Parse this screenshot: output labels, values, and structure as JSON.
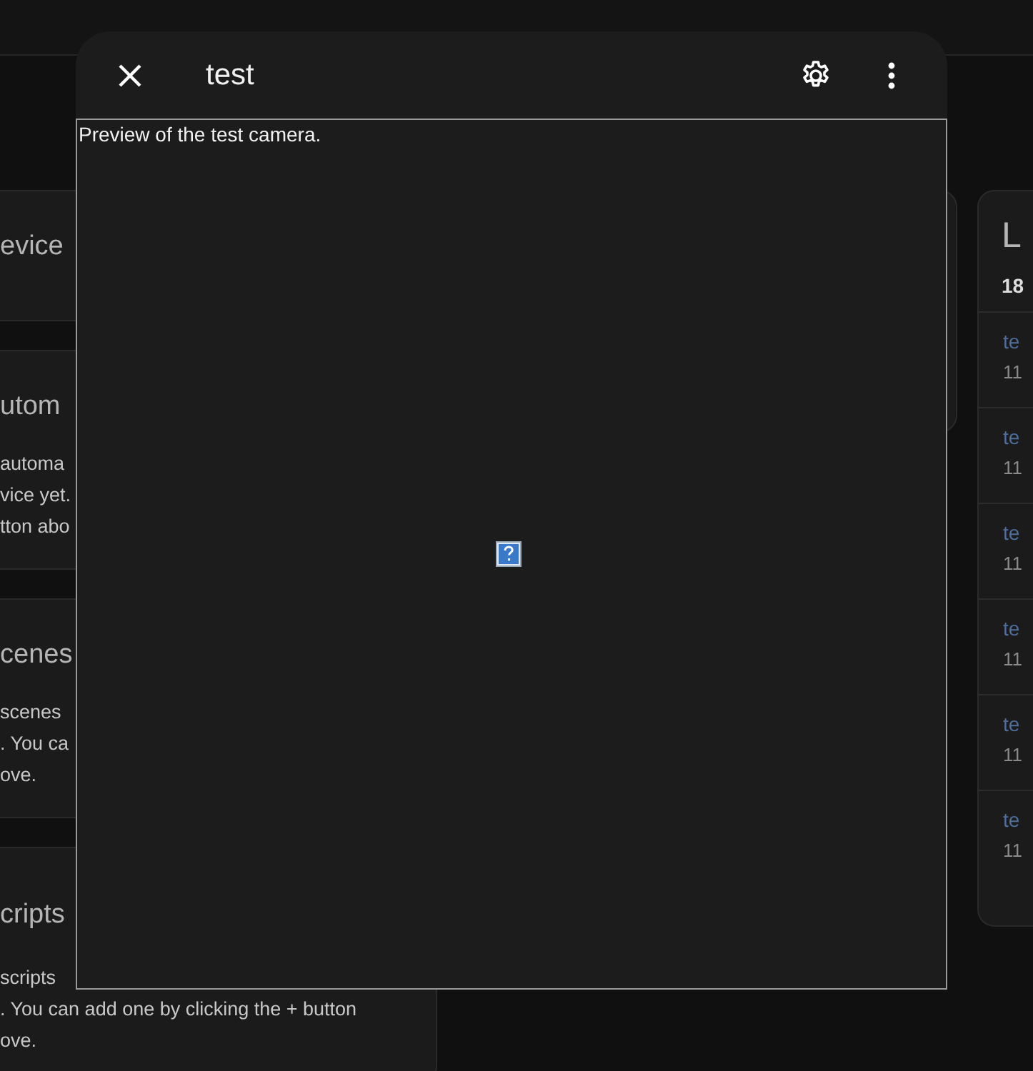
{
  "left_cards": [
    {
      "title": "evice"
    },
    {
      "title": "utom",
      "lines": [
        " automa",
        "vice yet.",
        "tton abo"
      ]
    },
    {
      "title": "cenes",
      "lines": [
        " scenes",
        ". You ca",
        "ove."
      ]
    },
    {
      "title": "cripts",
      "lines": [
        " scripts",
        ". You can add one by clicking the + button",
        "ove."
      ]
    }
  ],
  "logbook_card": {
    "title": "L",
    "date": "18",
    "entries": [
      {
        "name": "te",
        "time": "11"
      },
      {
        "name": "te",
        "time": "11"
      },
      {
        "name": "te",
        "time": "11"
      },
      {
        "name": "te",
        "time": "11"
      },
      {
        "name": "te",
        "time": "11"
      },
      {
        "name": "te",
        "time": "11"
      }
    ]
  },
  "dialog": {
    "title": "test",
    "preview_text": "Preview of the test camera."
  }
}
